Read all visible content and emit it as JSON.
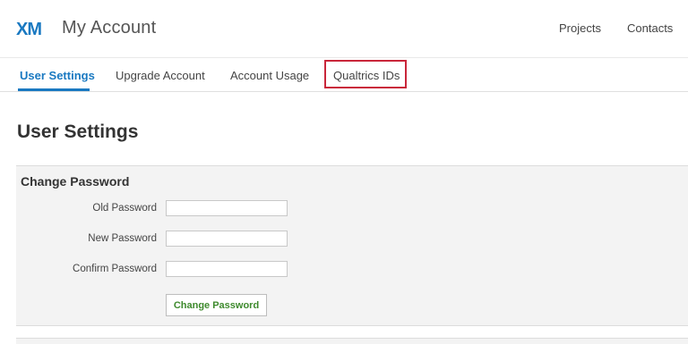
{
  "header": {
    "logo_text": "XM",
    "title": "My Account",
    "links": [
      "Projects",
      "Contacts"
    ]
  },
  "tabs": [
    {
      "label": "User Settings",
      "active": true
    },
    {
      "label": "Upgrade Account",
      "active": false
    },
    {
      "label": "Account Usage",
      "active": false
    },
    {
      "label": "Qualtrics IDs",
      "active": false,
      "highlighted": true
    }
  ],
  "page_title": "User Settings",
  "change_password": {
    "title": "Change Password",
    "fields": [
      {
        "label": "Old Password",
        "value": ""
      },
      {
        "label": "New Password",
        "value": ""
      },
      {
        "label": "Confirm Password",
        "value": ""
      }
    ],
    "button_label": "Change Password"
  },
  "colors": {
    "logo": "#1a79c1",
    "active_tab": "#1a79c1",
    "highlight_border": "#c9263a",
    "button_text": "#3e8a2d",
    "panel_bg": "#f3f3f3"
  }
}
